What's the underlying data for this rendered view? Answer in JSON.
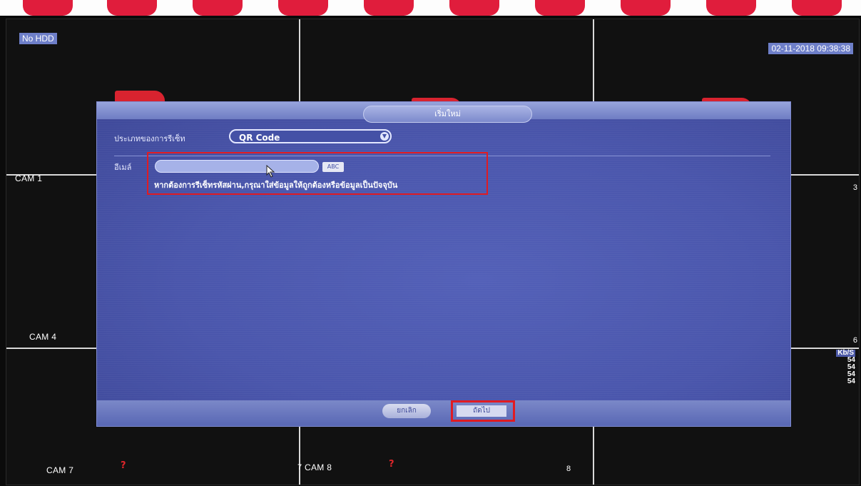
{
  "status": {
    "no_hdd": "No HDD",
    "datetime": "02-11-2018 09:38:38"
  },
  "cameras": {
    "cam1": "CAM 1",
    "cam4": "CAM 4",
    "cam7": "CAM 7",
    "cam8": "CAM 8",
    "seven": "7",
    "eight": "8",
    "three": "3",
    "six": "6",
    "qmark": "?"
  },
  "bitrate": {
    "unit": "Kb/S",
    "values": [
      "54",
      "54",
      "54",
      "54"
    ]
  },
  "dialog": {
    "title": "เริ่มใหม่",
    "type_label": "ประเภทของการรีเซ็ท",
    "type_value": "QR Code",
    "sn_label": "อีเมล์",
    "sn_value": "",
    "abc_label": "ABC",
    "hint": "หากต้องการรีเซ็ทรหัสผ่าน,กรุณาใส่ข้อมูลให้ถูกต้องหรือข้อมูลเป็นปัจจุบัน",
    "cancel": "ยกเลิก",
    "next": "ถัดไป"
  },
  "colors": {
    "dialog_bg": "#4a56ac",
    "highlight": "#e11b22",
    "brand_red": "#d8232f"
  }
}
